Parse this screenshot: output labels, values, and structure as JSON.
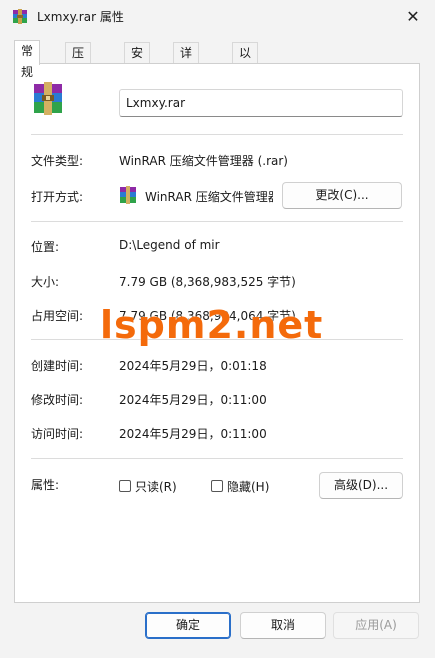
{
  "window": {
    "title": "Lxmxy.rar 属性"
  },
  "tabs": [
    {
      "label": "常规",
      "active": true
    },
    {
      "label": "压缩文件",
      "active": false
    },
    {
      "label": "安全",
      "active": false
    },
    {
      "label": "详细信息",
      "active": false
    },
    {
      "label": "以前的版本",
      "active": false
    }
  ],
  "general": {
    "file_name": "Lxmxy.rar",
    "file_type_label": "文件类型:",
    "file_type_value": "WinRAR 压缩文件管理器 (.rar)",
    "open_with_label": "打开方式:",
    "open_with_value": "WinRAR 压缩文件管理器",
    "change_button": "更改(C)...",
    "location_label": "位置:",
    "location_value": "D:\\Legend of mir",
    "size_label": "大小:",
    "size_value": "7.79 GB (8,368,983,525 字节)",
    "size_on_disk_label": "占用空间:",
    "size_on_disk_value": "7.79 GB (8,368,984,064 字节)",
    "created_label": "创建时间:",
    "created_value": "2024年5月29日，0:01:18",
    "modified_label": "修改时间:",
    "modified_value": "2024年5月29日，0:11:00",
    "accessed_label": "访问时间:",
    "accessed_value": "2024年5月29日，0:11:00",
    "attributes_label": "属性:",
    "readonly_label": "只读(R)",
    "hidden_label": "隐藏(H)",
    "advanced_button": "高级(D)..."
  },
  "footer": {
    "ok": "确定",
    "cancel": "取消",
    "apply": "应用(A)"
  },
  "watermark": "lspm2.net",
  "colors": {
    "accent": "#2a6fc9",
    "watermark": "#f46a0b"
  }
}
